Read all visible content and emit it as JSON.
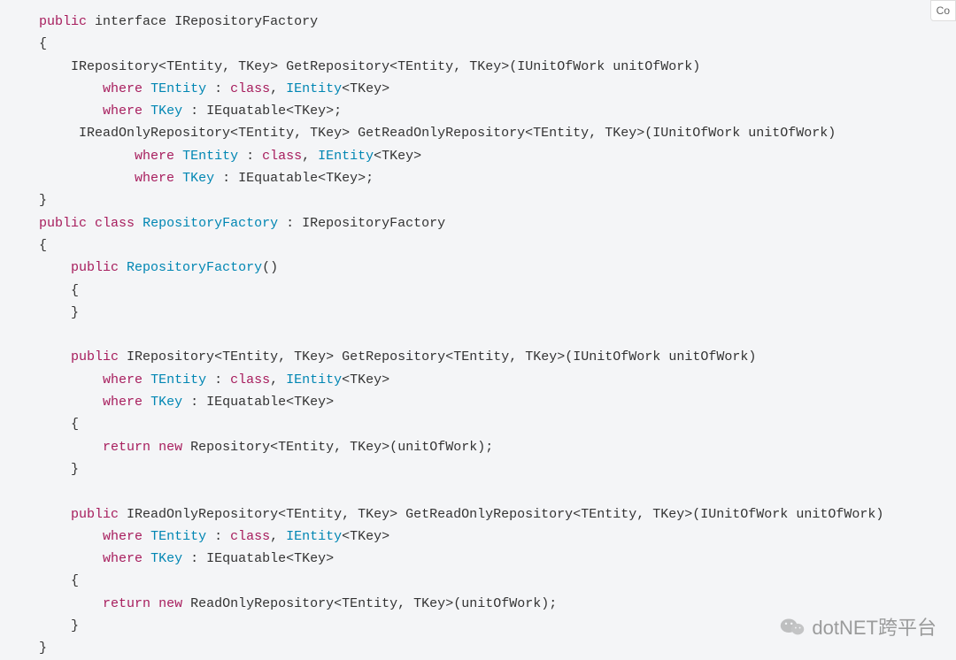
{
  "copy_label": "Co",
  "watermark_text": "dotNET跨平台",
  "code": {
    "kw_public": "public",
    "kw_interface": "interface",
    "kw_class": "class",
    "kw_where": "where",
    "kw_return": "return",
    "kw_new": "new",
    "iface_name": "IRepositoryFactory",
    "cls_name": "RepositoryFactory",
    "irepository": "IRepository",
    "ireadonlyrepository": "IReadOnlyRepository",
    "repository": "Repository",
    "readonlyrepo": "ReadOnlyRepository",
    "tentity": "TEntity",
    "tkey": "TKey",
    "getrepo": "GetRepository",
    "getroro": "GetReadOnlyRepository",
    "iunitofwork": "IUnitOfWork",
    "unitofwork": "unitOfWork",
    "iequatable": "IEquatable",
    "ientity": "IEntity"
  }
}
